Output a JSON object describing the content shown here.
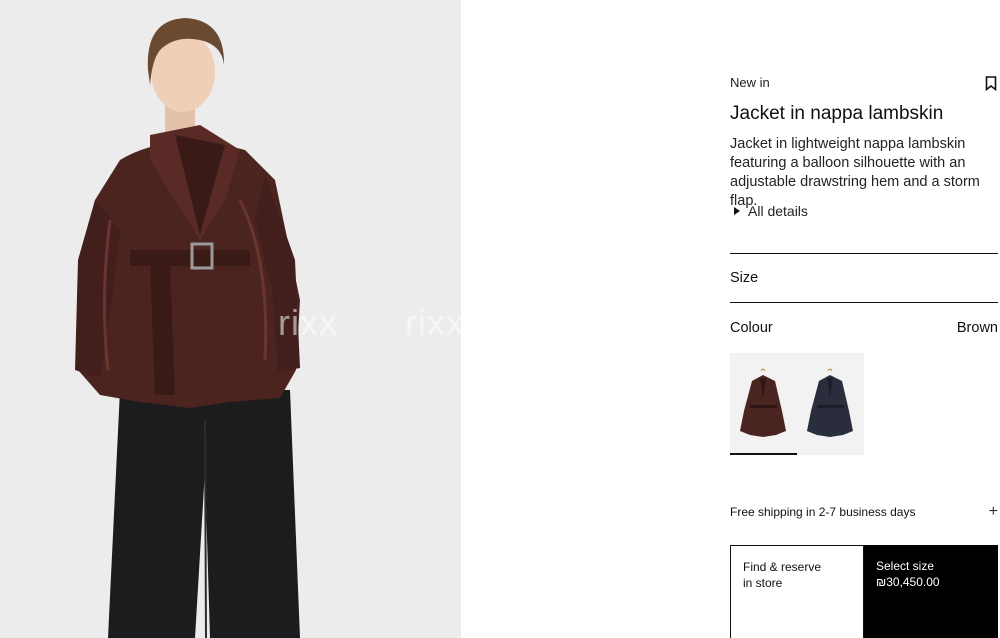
{
  "hero": {
    "image_alt": "Model wearing brown nappa lambskin jacket with belt and black wide trousers",
    "watermarks": [
      "rixx",
      "rixx"
    ]
  },
  "product": {
    "badge": "New in",
    "title": "Jacket in nappa lambskin",
    "description": "Jacket in lightweight nappa lambskin featuring a balloon silhouette with an adjustable drawstring hem and a storm flap.",
    "details_label": "All details",
    "bookmark_icon": "bookmark-icon"
  },
  "size": {
    "label": "Size"
  },
  "colour": {
    "label": "Colour",
    "selected": "Brown",
    "swatches": [
      {
        "name": "Brown",
        "color": "#4a2420",
        "selected": true
      },
      {
        "name": "Navy",
        "color": "#2a2e3c",
        "selected": false
      }
    ]
  },
  "shipping": {
    "label": "Free shipping in 2-7 business days",
    "icon": "plus-icon"
  },
  "actions": {
    "store_line1": "Find & reserve",
    "store_line2": "in store",
    "buy_line1": "Select size",
    "price": "₪30,450.00"
  }
}
